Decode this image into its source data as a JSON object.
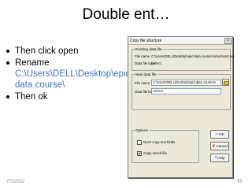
{
  "slide": {
    "title": "Double ent…",
    "bullets": [
      {
        "text": "Then click open"
      },
      {
        "text": "Rename",
        "path": "C:\\Users\\DELL\\Desktop\\epid data course\\"
      },
      {
        "text": "Then ok"
      }
    ],
    "date": "7/7/2022",
    "page": "65"
  },
  "dialog": {
    "title": "Copy file structure",
    "close_glyph": "×",
    "existing": {
      "legend": "Existing data file",
      "file_name_label": "File name",
      "file_name_value": "C:\\Users\\DELL\\Desktop\\epid data course\\correction3.rec",
      "data_label_label": "Data file label",
      "data_label_value": "correct"
    },
    "new": {
      "legend": "New data file",
      "file_name_label": "File name",
      "file_name_value": "C:\\Users\\DELL\\Desktop\\epid data course\\e...",
      "data_label_label": "Data file label",
      "data_label_value": "correct"
    },
    "options": {
      "legend": "Options",
      "dont_copy_label": "Don't copy text fields",
      "dont_copy_checked": false,
      "copy_check_label": "Copy check file",
      "copy_check_checked": true
    },
    "buttons": {
      "ok": "OK",
      "cancel": "Cancel",
      "help": "Help"
    }
  }
}
